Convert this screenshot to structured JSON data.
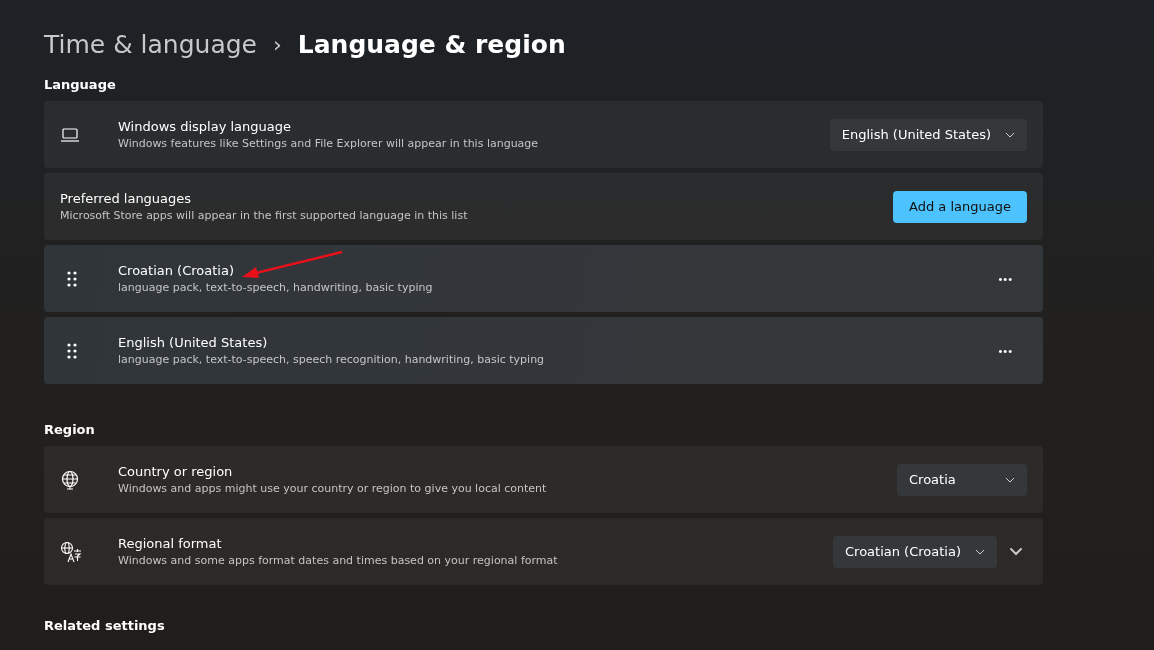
{
  "breadcrumb": {
    "parent": "Time & language",
    "separator": "›",
    "current": "Language & region"
  },
  "sections": [
    {
      "heading": "Language",
      "cards": [
        {
          "kind": "dropdown",
          "title": "Windows display language",
          "subtitle": "Windows features like Settings and File Explorer will appear in this language",
          "value": "English (United States)"
        },
        {
          "kind": "action",
          "title": "Preferred languages",
          "subtitle": "Microsoft Store apps will appear in the first supported language in this list",
          "button": "Add a language"
        },
        {
          "kind": "language",
          "title": "Croatian (Croatia)",
          "subtitle": "language pack, text-to-speech, handwriting, basic typing",
          "more": "•••"
        },
        {
          "kind": "language",
          "title": "English (United States)",
          "subtitle": "language pack, text-to-speech, speech recognition, handwriting, basic typing",
          "more": "•••"
        }
      ]
    },
    {
      "heading": "Region",
      "cards": [
        {
          "kind": "dropdown",
          "title": "Country or region",
          "subtitle": "Windows and apps might use your country or region to give you local content",
          "value": "Croatia"
        },
        {
          "kind": "dropdown",
          "title": "Regional format",
          "subtitle": "Windows and some apps format dates and times based on your regional format",
          "value": "Croatian (Croatia)",
          "expanded": false
        }
      ]
    },
    {
      "heading": "Related settings"
    }
  ]
}
